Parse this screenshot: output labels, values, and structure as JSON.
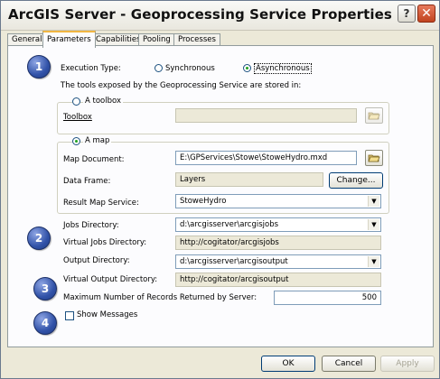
{
  "window": {
    "title": "ArcGIS Server - Geoprocessing Service Properties"
  },
  "titlebar": {
    "help_label": "?",
    "close_label": "✕"
  },
  "tabs": [
    {
      "label": "General"
    },
    {
      "label": "Parameters"
    },
    {
      "label": "Capabilities"
    },
    {
      "label": "Pooling"
    },
    {
      "label": "Processes"
    }
  ],
  "badges": [
    "1",
    "2",
    "3",
    "4"
  ],
  "execution": {
    "label": "Execution Type:",
    "options": [
      "Synchronous",
      "Asynchronous"
    ],
    "selected": "Asynchronous",
    "note": "The tools exposed by the Geoprocessing Service are stored in:"
  },
  "toolbox_group": {
    "radio_label": "A toolbox",
    "toolbox_label": "Toolbox",
    "toolbox_value": ""
  },
  "map_group": {
    "radio_label": "A map",
    "map_document_label": "Map Document:",
    "map_document_value": "E:\\GPServices\\Stowe\\StoweHydro.mxd",
    "data_frame_label": "Data Frame:",
    "data_frame_value": "Layers",
    "change_label": "Change...",
    "result_map_service_label": "Result Map Service:",
    "result_map_service_value": "StoweHydro"
  },
  "directories": {
    "jobs_label": "Jobs Directory:",
    "jobs_value": "d:\\arcgisserver\\arcgisjobs",
    "virtual_jobs_label": "Virtual Jobs Directory:",
    "virtual_jobs_value": "http://cogitator/arcgisjobs",
    "output_label": "Output Directory:",
    "output_value": "d:\\arcgisserver\\arcgisoutput",
    "virtual_output_label": "Virtual Output Directory:",
    "virtual_output_value": "http://cogitator/arcgisoutput"
  },
  "max_records": {
    "label": "Maximum Number of Records Returned by Server:",
    "value": "500"
  },
  "show_messages": {
    "label": "Show Messages",
    "checked": false
  },
  "footer": {
    "ok_label": "OK",
    "cancel_label": "Cancel",
    "apply_label": "Apply"
  },
  "icons": {
    "folder": "folder-open-icon",
    "dropdown": "chevron-down-icon"
  }
}
